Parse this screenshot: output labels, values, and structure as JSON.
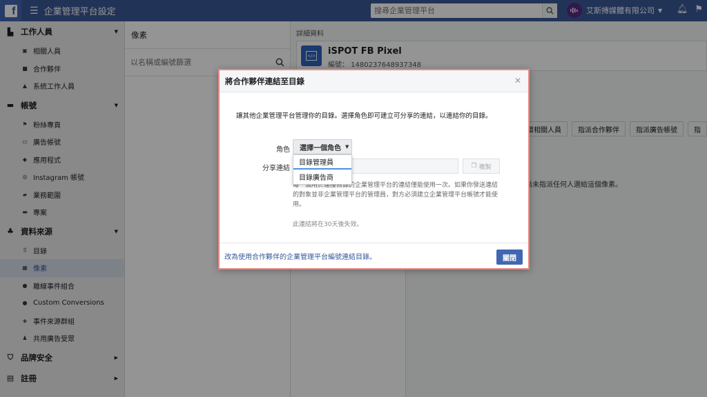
{
  "topbar": {
    "title": "企業管理平台設定",
    "search_placeholder": "搜尋企業管理平台",
    "company_name": "艾斯摶媒體有限公司"
  },
  "sidebar": {
    "sections": [
      {
        "label": "工作人員",
        "icon": "people-icon",
        "items": [
          "相關人員",
          "合作夥伴",
          "系統工作人員"
        ]
      },
      {
        "label": "帳號",
        "icon": "accounts-icon",
        "items": [
          "粉絲專頁",
          "廣告帳號",
          "應用程式",
          "Instagram 帳號",
          "業務範圍",
          "專案"
        ]
      },
      {
        "label": "資料來源",
        "icon": "data-sources-icon",
        "items": [
          "目錄",
          "像素",
          "離線事件組合",
          "Custom Conversions",
          "事件來源群組",
          "共用廣告受眾"
        ]
      },
      {
        "label": "品牌安全",
        "icon": "shield-icon",
        "items": []
      },
      {
        "label": "註冊",
        "icon": "register-icon",
        "items": []
      }
    ],
    "active_item": "像素"
  },
  "list": {
    "header": "像素",
    "search_placeholder": "以名稱或編號篩選"
  },
  "details": {
    "label": "詳細資料",
    "pixel_name": "iSPOT FB Pixel",
    "pixel_id": "編號： 1480237648937348",
    "actions": [
      "新增相關人員",
      "指派合作夥伴",
      "指派廣告帳號",
      "指"
    ],
    "empty_text": "尚未指派任何人選給這個像素。"
  },
  "modal": {
    "title": "將合作夥伴連結至目錄",
    "intro": "讓其他企業管理平台管理你的目錄。選擇角色即可建立可分享的連結，以連結你的目錄。",
    "role_label": "角色",
    "role_button": "選擇一個角色",
    "share_label": "分享連結",
    "copy_label": "複製",
    "note": "每一個用於連接目錄的企業管理平台的連結僅能使用一次。如果你發送連結的對象並非企業管理平台的管理員，對方必須建立企業管理平台帳號才能使用。",
    "expire": "此連結將在30天後失效。",
    "footer_link": "改為使用合作夥伴的企業管理平台編號連結目錄。",
    "close_button": "關閉",
    "role_options": [
      "目錄管理員",
      "目錄廣告商"
    ]
  }
}
